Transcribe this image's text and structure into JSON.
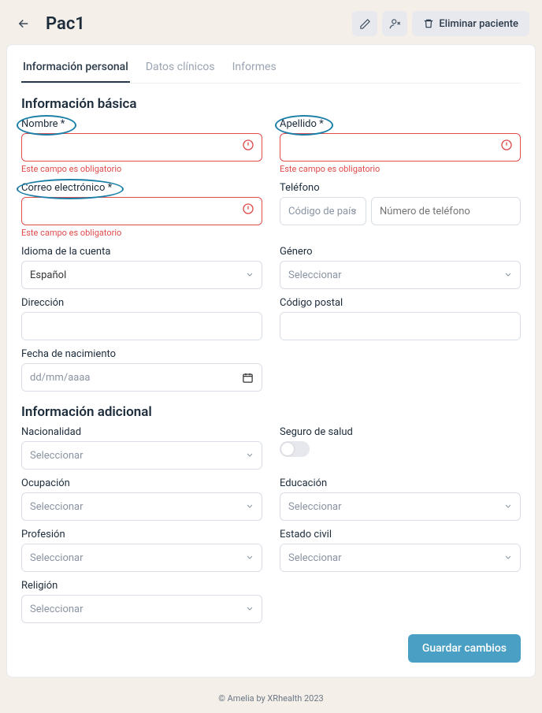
{
  "header": {
    "title": "Pac1",
    "delete_label": "Eliminar paciente"
  },
  "tabs": [
    {
      "label": "Información personal",
      "active": true
    },
    {
      "label": "Datos clínicos",
      "active": false
    },
    {
      "label": "Informes",
      "active": false
    }
  ],
  "section_basic": "Información básica",
  "section_additional": "Información adicional",
  "labels": {
    "name": "Nombre *",
    "surname": "Apellido *",
    "email": "Correo electrónico *",
    "phone": "Teléfono",
    "phone_code_placeholder": "Código de país",
    "phone_num_placeholder": "Número de teléfono",
    "language": "Idioma de la cuenta",
    "language_value": "Español",
    "gender": "Género",
    "select_placeholder": "Seleccionar",
    "address": "Dirección",
    "postal": "Código postal",
    "birth": "Fecha de nacimiento",
    "birth_placeholder": "dd/mm/aaaa",
    "nationality": "Nacionalidad",
    "insurance": "Seguro de salud",
    "occupation": "Ocupación",
    "education": "Educación",
    "profession": "Profesión",
    "civil": "Estado civil",
    "religion": "Religión"
  },
  "error_required": "Este campo es obligatorio",
  "save_btn": "Guardar cambios",
  "footer": "© Amelia by XRhealth 2023"
}
